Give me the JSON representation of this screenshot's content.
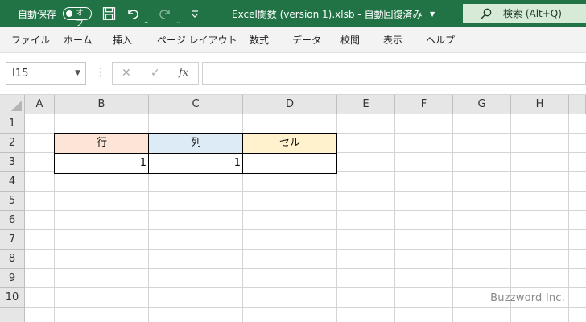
{
  "titlebar": {
    "autosave_label": "自動保存",
    "autosave_state": "オフ",
    "document_title": "Excel関数 (version 1).xlsb  -  自動回復済み",
    "search_text": "検索 (Alt+Q)",
    "accent_color": "#217346"
  },
  "menu": {
    "items": [
      "ファイル",
      "ホーム",
      "挿入",
      "ページ レイアウト",
      "数式",
      "データ",
      "校閲",
      "表示",
      "ヘルプ"
    ]
  },
  "formula_bar": {
    "name_box_value": "I15",
    "fx_label": "fx",
    "formula_value": ""
  },
  "sheet": {
    "columns": [
      "A",
      "B",
      "C",
      "D",
      "E",
      "F",
      "G",
      "H"
    ],
    "rows": [
      "1",
      "2",
      "3",
      "4",
      "5",
      "6",
      "7",
      "8",
      "9",
      "10"
    ],
    "cells": {
      "B2": {
        "value": "行",
        "fill": "#fce4d6"
      },
      "C2": {
        "value": "列",
        "fill": "#ddebf7"
      },
      "D2": {
        "value": "セル",
        "fill": "#fff2cc"
      },
      "B3": {
        "value": "1"
      },
      "C3": {
        "value": "1"
      },
      "D3": {
        "value": ""
      }
    }
  },
  "watermark": "Buzzword Inc."
}
